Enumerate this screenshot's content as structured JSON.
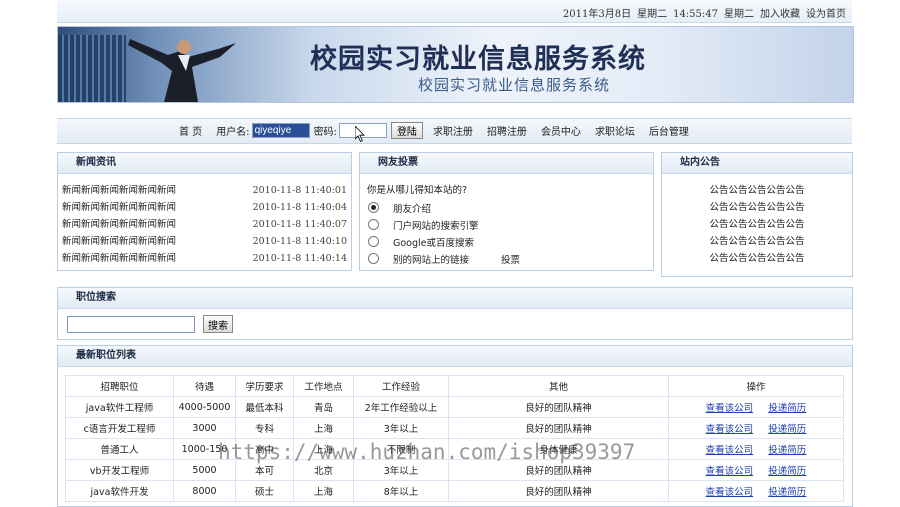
{
  "topbar": {
    "date": "2011年3月8日",
    "weekday1": "星期二",
    "time": "14:55:47",
    "weekday2": "星期二",
    "add_favorite": "加入收藏",
    "set_home": "设为首页"
  },
  "banner": {
    "title": "校园实习就业信息服务系统",
    "subtitle": "校园实习就业信息服务系统"
  },
  "nav": {
    "home": "首 页",
    "username_label": "用户名:",
    "username_value": "qiyeqiye",
    "password_label": "密码:",
    "login_button": "登陆",
    "links": [
      "求职注册",
      "招聘注册",
      "会员中心",
      "求职论坛",
      "后台管理"
    ]
  },
  "news": {
    "title": "新闻资讯",
    "items": [
      {
        "text": "新闻新闻新闻新闻新闻新闻",
        "date": "2010-11-8 11:40:01"
      },
      {
        "text": "新闻新闻新闻新闻新闻新闻",
        "date": "2010-11-8 11:40:04"
      },
      {
        "text": "新闻新闻新闻新闻新闻新闻",
        "date": "2010-11-8 11:40:07"
      },
      {
        "text": "新闻新闻新闻新闻新闻新闻",
        "date": "2010-11-8 11:40:10"
      },
      {
        "text": "新闻新闻新闻新闻新闻新闻",
        "date": "2010-11-8 11:40:14"
      }
    ]
  },
  "vote": {
    "title": "网友投票",
    "question": "你是从哪儿得知本站的?",
    "options": [
      "朋友介绍",
      "门户网站的搜索引擎",
      "Google或百度搜索",
      "别的网站上的链接"
    ],
    "selected_index": 0,
    "vote_button": "投票"
  },
  "notice": {
    "title": "站内公告",
    "items": [
      "公告公告公告公告公告",
      "公告公告公告公告公告",
      "公告公告公告公告公告",
      "公告公告公告公告公告",
      "公告公告公告公告公告"
    ]
  },
  "job_search": {
    "title": "职位搜索",
    "input_value": "",
    "button": "搜索"
  },
  "job_list": {
    "title": "最新职位列表",
    "columns": [
      "招聘职位",
      "待遇",
      "学历要求",
      "工作地点",
      "工作经验",
      "其他",
      "操作"
    ],
    "rows": [
      {
        "position": "java软件工程师",
        "salary": "4000-5000",
        "education": "最低本科",
        "location": "青岛",
        "experience": "2年工作经验以上",
        "other": "良好的团队精神"
      },
      {
        "position": "c语言开发工程师",
        "salary": "3000",
        "education": "专科",
        "location": "上海",
        "experience": "3年以上",
        "other": "良好的团队精神"
      },
      {
        "position": "普通工人",
        "salary": "1000-150",
        "education": "高中",
        "location": "上海",
        "experience": "不限制",
        "other": "身体健康"
      },
      {
        "position": "vb开发工程师",
        "salary": "5000",
        "education": "本可",
        "location": "北京",
        "experience": "3年以上",
        "other": "良好的团队精神"
      },
      {
        "position": "java软件开发",
        "salary": "8000",
        "education": "硕士",
        "location": "上海",
        "experience": "8年以上",
        "other": "良好的团队精神"
      }
    ],
    "action_view": "查看该公司",
    "action_apply": "投递简历"
  },
  "watermark": "https://www.huzhan.com/ishop39397"
}
